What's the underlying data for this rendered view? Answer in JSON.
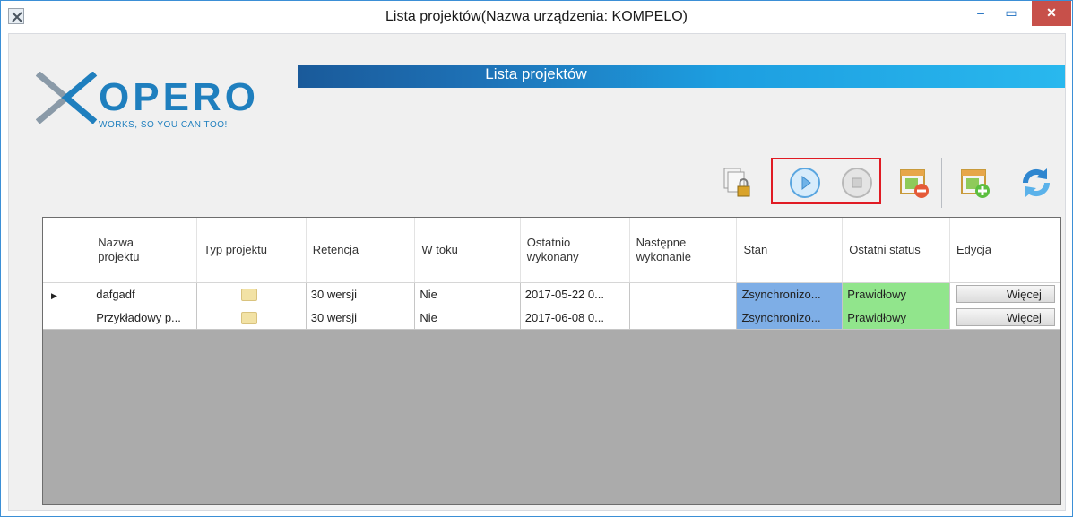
{
  "window": {
    "title": "Lista projektów(Nazwa urządzenia: KOMPELO)",
    "controls": {
      "minimize": "–",
      "maximize": "▭",
      "close": "✕"
    }
  },
  "logo": {
    "word": "OPERO",
    "tagline": "WORKS, SO YOU CAN TOO!"
  },
  "banner": {
    "title": "Lista projektów"
  },
  "toolbar": {
    "icons": [
      "secure-copy-icon",
      "play-icon",
      "stop-icon",
      "remove-schedule-icon",
      "add-schedule-icon",
      "refresh-icon"
    ]
  },
  "table": {
    "columns": [
      "Nazwa projektu",
      "Typ projektu",
      "Retencja",
      "W toku",
      "Ostatnio wykonany",
      "Następne wykonanie",
      "Stan",
      "Ostatni status",
      "Edycja"
    ],
    "rows": [
      {
        "name": "dafgadf",
        "retention": "30 wersji",
        "in_progress": "Nie",
        "last_run": "2017-05-22 0...",
        "next_run": "",
        "state": "Zsynchronizo...",
        "last_status": "Prawidłowy",
        "edit_label": "Więcej"
      },
      {
        "name": "Przykładowy p...",
        "retention": "30 wersji",
        "in_progress": "Nie",
        "last_run": "2017-06-08 0...",
        "next_run": "",
        "state": "Zsynchronizo...",
        "last_status": "Prawidłowy",
        "edit_label": "Więcej"
      }
    ]
  },
  "colors": {
    "accent": "#1f7fbe",
    "state_bg": "#7eaee6",
    "status_ok_bg": "#91e58c",
    "highlight": "#e01b24"
  }
}
